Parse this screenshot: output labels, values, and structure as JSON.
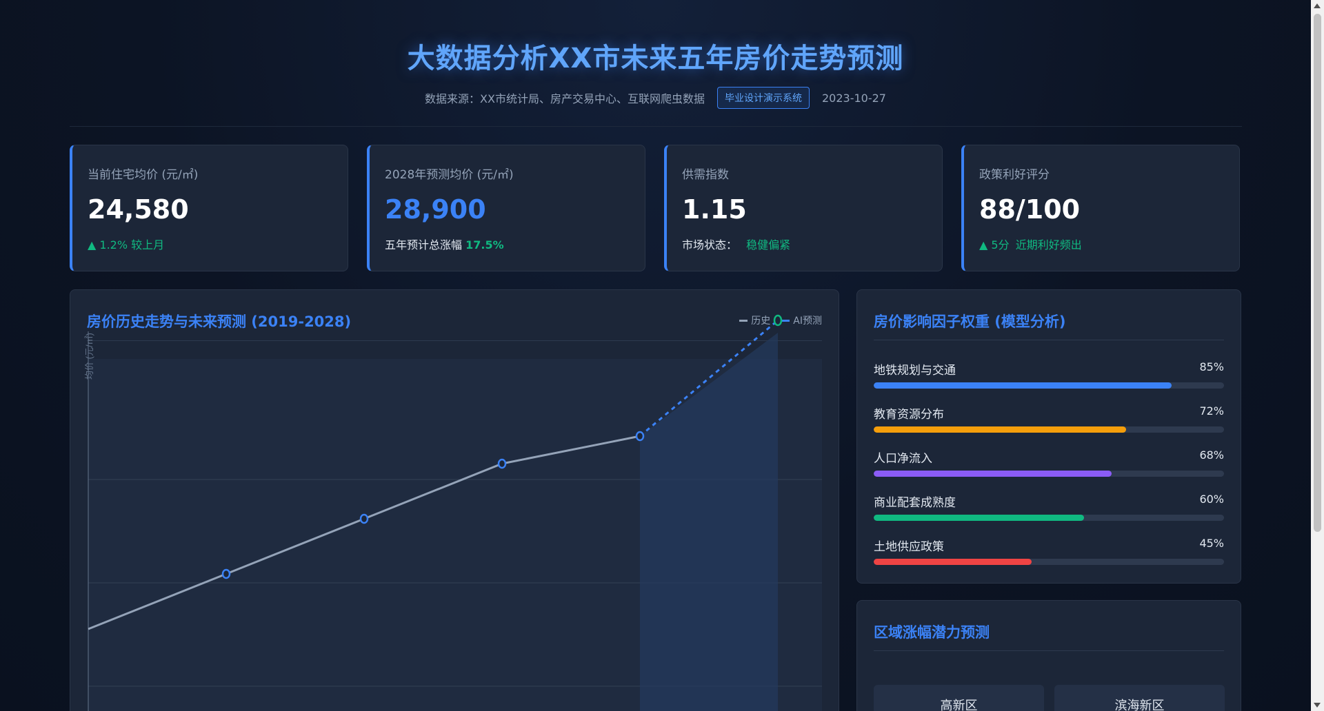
{
  "header": {
    "title": "大数据分析XX市未来五年房价走势预测",
    "source": "数据来源：XX市统计局、房产交易中心、互联网爬虫数据",
    "badge": "毕业设计演示系统",
    "date": "2023-10-27"
  },
  "kpis": [
    {
      "label": "当前住宅均价 (元/㎡)",
      "value": "24,580",
      "sub_arrow": "▲",
      "sub_prefix": "1.2%",
      "sub_text": "较上月"
    },
    {
      "label": "2028年预测均价 (元/㎡)",
      "value": "28,900",
      "sub_text": "五年预计总涨幅",
      "sub_value": "17.5%"
    },
    {
      "label": "供需指数",
      "value": "1.15",
      "sub_text": "市场状态：",
      "sub_value": "稳健偏紧"
    },
    {
      "label": "政策利好评分",
      "value": "88/100",
      "sub_arrow": "▲",
      "sub_prefix": "5分",
      "sub_text": "近期利好频出"
    }
  ],
  "trend_panel": {
    "title": "房价历史走势与未来预测 (2019-2028)",
    "y_axis_label": "均价 (元/㎡)",
    "legend": [
      {
        "name": "历史",
        "color": "#94a3b8"
      },
      {
        "name": "AI预测",
        "color": "#3b82f6"
      }
    ]
  },
  "chart_data": {
    "type": "line",
    "title": "房价历史走势与未来预测 (2019-2028)",
    "ylabel": "均价 (元/㎡)",
    "grid": true,
    "series": [
      {
        "name": "历史",
        "color": "#94a3b8",
        "style": "solid",
        "points": [
          [
            0,
            0.16
          ],
          [
            1,
            0.26
          ],
          [
            2,
            0.36
          ],
          [
            3,
            0.46
          ],
          [
            4,
            0.51
          ]
        ]
      },
      {
        "name": "AI预测",
        "color": "#3b82f6",
        "style": "dashed",
        "points": [
          [
            4,
            0.51
          ],
          [
            5,
            0.72
          ]
        ]
      }
    ]
  },
  "factor_panel": {
    "title": "房价影响因子权重 (模型分析)",
    "items": [
      {
        "name": "地铁规划与交通",
        "pct": "85%",
        "value": 85,
        "color": "#3b82f6"
      },
      {
        "name": "教育资源分布",
        "pct": "72%",
        "value": 72,
        "color": "#f59e0b"
      },
      {
        "name": "人口净流入",
        "pct": "68%",
        "value": 68,
        "color": "#8b5cf6"
      },
      {
        "name": "商业配套成熟度",
        "pct": "60%",
        "value": 60,
        "color": "#10b981"
      },
      {
        "name": "土地供应政策",
        "pct": "45%",
        "value": 45,
        "color": "#ef4444"
      }
    ]
  },
  "region_panel": {
    "title": "区域涨幅潜力预测",
    "regions": [
      "高新区",
      "滨海新区"
    ]
  }
}
